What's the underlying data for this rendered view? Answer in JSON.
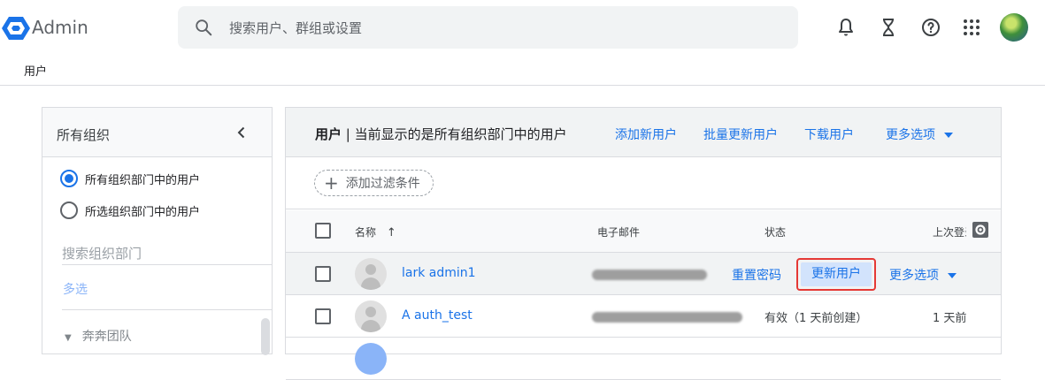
{
  "app": {
    "title": "Admin",
    "brand_color": "#1a73e8"
  },
  "search": {
    "placeholder": "搜索用户、群组或设置"
  },
  "top_icons": [
    "bell-icon",
    "hourglass-icon",
    "help-icon",
    "apps-grid-icon",
    "account-avatar"
  ],
  "breadcrumb": "用户",
  "sidebar": {
    "title": "所有组织",
    "radio_options": [
      {
        "label": "所有组织部门中的用户",
        "selected": true
      },
      {
        "label": "所选组织部门中的用户",
        "selected": false
      }
    ],
    "search_placeholder": "搜索组织部门",
    "multi_select": "多选",
    "team": "奔奔团队"
  },
  "main": {
    "title_bold": "用户",
    "title_rest": " | 当前显示的是所有组织部门中的用户",
    "actions": {
      "add": "添加新用户",
      "bulk": "批量更新用户",
      "download": "下载用户",
      "more": "更多选项"
    },
    "filter": "添加过滤条件",
    "columns": {
      "name": "名称",
      "email": "电子邮件",
      "status": "状态",
      "last_login": "上次登录"
    },
    "rows": [
      {
        "name": "lark admin1",
        "reset": "重置密码",
        "update": "更新用户",
        "more": "更多选项"
      },
      {
        "name": "A auth_test",
        "status": "有效（1 天前创建）",
        "last_login": "1 天前"
      }
    ]
  }
}
